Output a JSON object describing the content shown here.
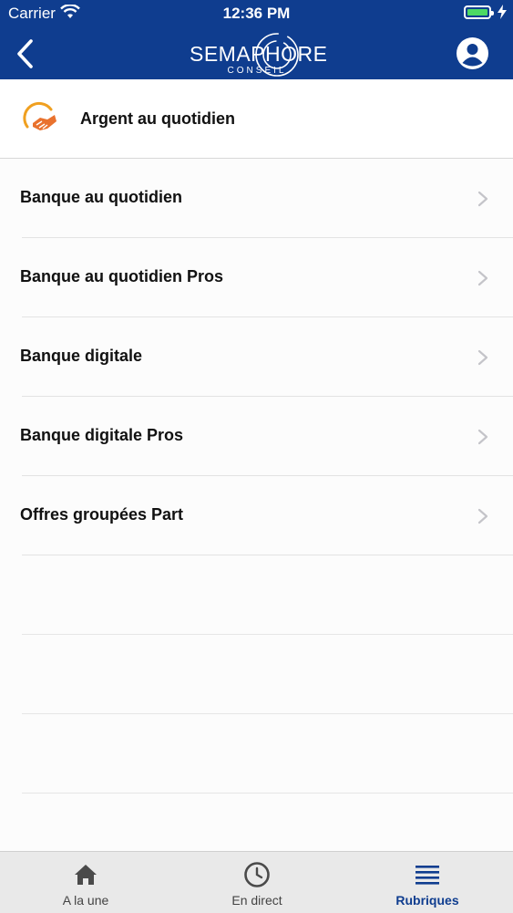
{
  "status_bar": {
    "carrier": "Carrier",
    "time": "12:36 PM",
    "battery_color": "#4cd964"
  },
  "navbar": {
    "background": "#0f3d8f",
    "back_icon": "chevron-left-icon",
    "logo_word": "SEMAPHORE",
    "logo_sub": "CONSEIL",
    "profile_icon": "user-circle-icon"
  },
  "header": {
    "icon": "handshake-icon",
    "title": "Argent au quotidien"
  },
  "list": {
    "items": [
      {
        "label": "Banque au quotidien"
      },
      {
        "label": "Banque au quotidien Pros"
      },
      {
        "label": "Banque digitale"
      },
      {
        "label": "Banque digitale Pros"
      },
      {
        "label": "Offres groupées Part"
      }
    ],
    "chevron_icon": "chevron-right-icon"
  },
  "tabbar": {
    "tabs": [
      {
        "label": "A la une",
        "icon": "home-icon",
        "active": false
      },
      {
        "label": "En direct",
        "icon": "clock-icon",
        "active": false
      },
      {
        "label": "Rubriques",
        "icon": "list-icon",
        "active": true
      }
    ],
    "active_color": "#0f3d8f"
  }
}
